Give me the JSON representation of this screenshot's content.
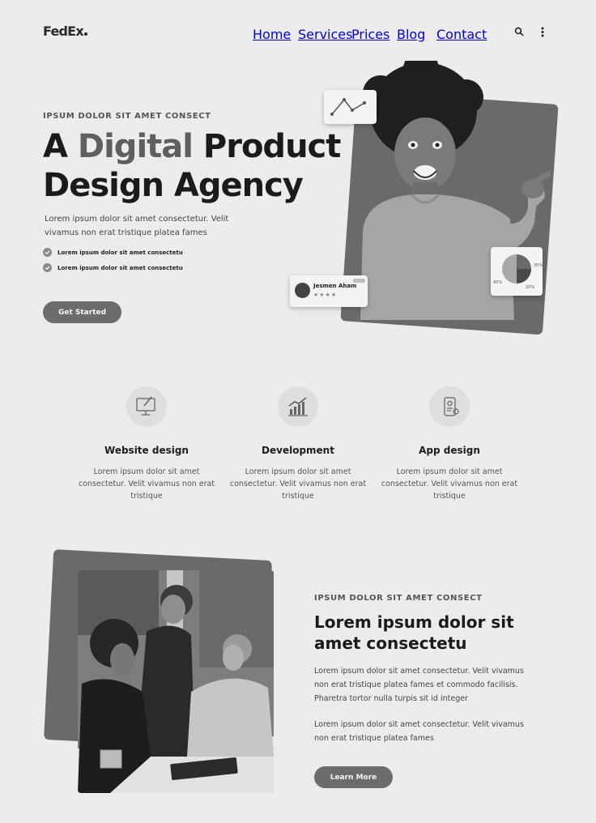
{
  "header": {
    "logo": "FedEx",
    "nav": [
      "Home",
      "Services",
      "Prices",
      "Blog",
      "Contact"
    ]
  },
  "hero": {
    "eyebrow": "IPSUM DOLOR SIT AMET CONSECT",
    "title_a": "A ",
    "title_highlight": "Digital",
    "title_b": " Product",
    "title_line2": "Design Agency",
    "description": "Lorem ipsum dolor sit amet consectetur. Velit vivamus non erat tristique platea fames",
    "checks": [
      "Lorem ipsum dolor sit amet consectetu",
      "Lorem ipsum dolor sit amet consectetu"
    ],
    "cta": "Get Started",
    "profile_name": "Jesmen Aham",
    "pie_labels": [
      "45%",
      "20%",
      "35%"
    ]
  },
  "services": [
    {
      "title": "Website design",
      "description": "Lorem ipsum dolor sit amet consectetur. Velit vivamus non erat tristique",
      "icon": "monitor-brush-icon"
    },
    {
      "title": "Development",
      "description": "Lorem ipsum dolor sit amet consectetur. Velit vivamus non erat tristique",
      "icon": "bar-growth-icon"
    },
    {
      "title": "App design",
      "description": "Lorem ipsum dolor sit amet consectetur. Velit vivamus non erat tristique",
      "icon": "mobile-settings-icon"
    }
  ],
  "about": {
    "eyebrow": "IPSUM DOLOR SIT AMET CONSECT",
    "title": "Lorem ipsum dolor sit amet consectetu",
    "paragraph1": "Lorem ipsum dolor sit amet consectetur. Velit vivamus non erat tristique platea fames et commodo facilisis. Pharetra tortor nulla turpis sit id integer",
    "paragraph2": "Lorem ipsum dolor sit amet consectetur. Velit vivamus non erat tristique platea fames",
    "cta": "Learn More"
  }
}
